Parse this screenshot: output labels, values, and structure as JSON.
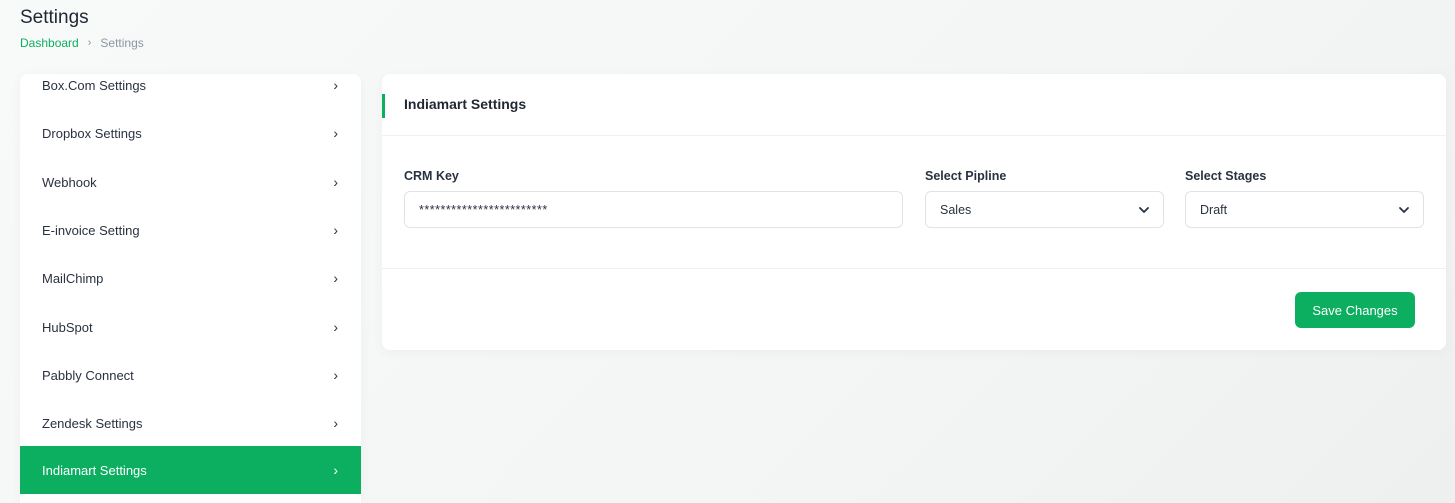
{
  "header": {
    "title": "Settings",
    "breadcrumb": {
      "home": "Dashboard",
      "separator": "›",
      "current": "Settings"
    }
  },
  "sidebar": {
    "items": [
      {
        "label": "Box.Com Settings",
        "chevron": "›"
      },
      {
        "label": "Dropbox Settings",
        "chevron": "›"
      },
      {
        "label": "Webhook",
        "chevron": "›"
      },
      {
        "label": "E-invoice Setting",
        "chevron": "›"
      },
      {
        "label": "MailChimp",
        "chevron": "›"
      },
      {
        "label": "HubSpot",
        "chevron": "›"
      },
      {
        "label": "Pabbly Connect",
        "chevron": "›"
      },
      {
        "label": "Zendesk Settings",
        "chevron": "›"
      },
      {
        "label": "Indiamart Settings",
        "chevron": "›",
        "active": true
      }
    ]
  },
  "card": {
    "title": "Indiamart Settings",
    "crm_key": {
      "label": "CRM Key",
      "value": "************************"
    },
    "pipeline": {
      "label": "Select Pipline",
      "value": "Sales"
    },
    "stages": {
      "label": "Select Stages",
      "value": "Draft"
    },
    "save_label": "Save Changes"
  },
  "colors": {
    "accent": "#0caf60",
    "text": "#293240",
    "muted": "#8a96a3"
  }
}
